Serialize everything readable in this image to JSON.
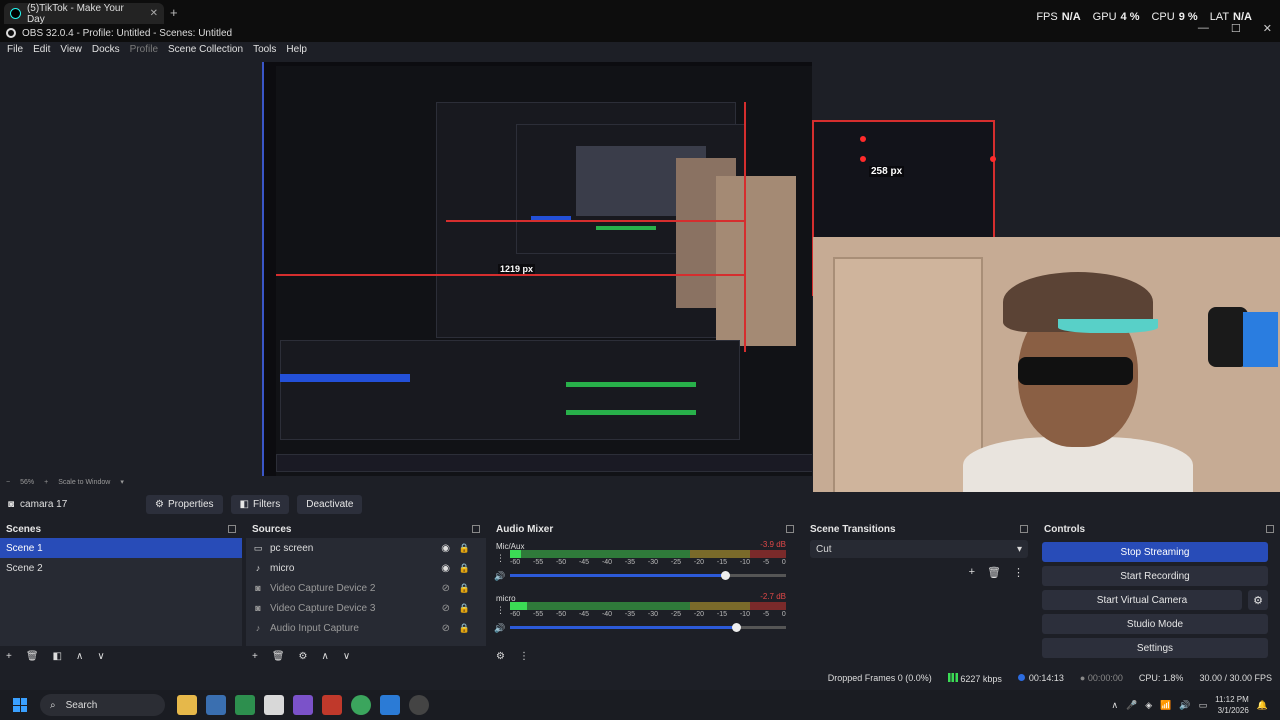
{
  "browser": {
    "tab_title": "(5)TikTok - Make Your Day",
    "tab_close": "✕",
    "new_tab": "+"
  },
  "window": {
    "title": "OBS 32.0.4 - Profile: Untitled - Scenes: Untitled",
    "minimize": "—",
    "maximize": "☐",
    "close": "✕"
  },
  "stats_overlay": {
    "fps_label": "FPS",
    "fps_value": "N/A",
    "gpu_label": "GPU",
    "gpu_value": "4 %",
    "cpu_label": "CPU",
    "cpu_value": "9 %",
    "lat_label": "LAT",
    "lat_value": "N/A"
  },
  "menu": [
    "File",
    "Edit",
    "View",
    "Docks",
    "Profile",
    "Scene Collection",
    "Tools",
    "Help"
  ],
  "preview": {
    "label_258": "258 px",
    "label_1219": "1219 px",
    "zoom_value": "56%",
    "zoom_mode": "Scale to Window"
  },
  "source_toolbar": {
    "source_name": "camara 17",
    "properties": "Properties",
    "filters": "Filters",
    "deactivate": "Deactivate"
  },
  "scenes": {
    "title": "Scenes",
    "items": [
      "Scene 1",
      "Scene 2"
    ]
  },
  "sources": {
    "title": "Sources",
    "items": [
      {
        "name": "pc screen",
        "icon": "monitor-icon"
      },
      {
        "name": "micro",
        "icon": "microphone-icon"
      },
      {
        "name": "Video Capture Device 2",
        "icon": "camera-icon"
      },
      {
        "name": "Video Capture Device 3",
        "icon": "camera-icon"
      },
      {
        "name": "Audio Input Capture",
        "icon": "microphone-icon"
      }
    ]
  },
  "audio_mixer": {
    "title": "Audio Mixer",
    "channels": [
      {
        "name": "Mic/Aux",
        "db": "-3.9 dB",
        "level": 0.04,
        "volume": 0.78
      },
      {
        "name": "micro",
        "db": "-2.7 dB",
        "level": 0.06,
        "volume": 0.82
      }
    ],
    "scale": [
      "-60",
      "-55",
      "-50",
      "-45",
      "-40",
      "-35",
      "-30",
      "-25",
      "-20",
      "-15",
      "-10",
      "-5",
      "0"
    ]
  },
  "transitions": {
    "title": "Scene Transitions",
    "selected": "Cut"
  },
  "controls": {
    "title": "Controls",
    "stop_streaming": "Stop Streaming",
    "start_recording": "Start Recording",
    "start_virtual_camera": "Start Virtual Camera",
    "studio_mode": "Studio Mode",
    "settings": "Settings"
  },
  "status": {
    "dropped_frames": "Dropped Frames 0 (0.0%)",
    "bitrate": "6227 kbps",
    "stream_time": "00:14:13",
    "record_time": "00:00:00",
    "cpu": "CPU: 1.8%",
    "fps": "30.00 / 30.00 FPS"
  },
  "taskbar": {
    "search": "Search",
    "time": "11:12 PM",
    "date": "3/1/2026"
  },
  "colors": {
    "accent": "#284cb8",
    "panel": "#272a33",
    "bg": "#1d1f26",
    "selection_red": "#d52e2e"
  }
}
